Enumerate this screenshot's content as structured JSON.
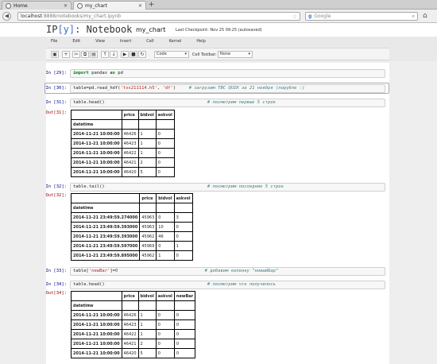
{
  "browser": {
    "tabs": [
      {
        "label": "Home",
        "active": false
      },
      {
        "label": "my_chart",
        "active": true
      }
    ],
    "url_host": "localhost",
    "url_path": ":8888/notebooks/my_chart.ipynb",
    "search_engine": "Google",
    "search_placeholder": "Google"
  },
  "header": {
    "logo_ip": "IP",
    "logo_y": "[y]",
    "logo_text": ": Notebook",
    "notebook_name": "my_chart",
    "checkpoint": "Last Checkpoint: Nov 25 09:25 (autosaved)"
  },
  "menu": [
    "File",
    "Edit",
    "View",
    "Insert",
    "Cell",
    "Kernel",
    "Help"
  ],
  "toolbar": {
    "cell_type": "Code",
    "cell_toolbar_label": "Cell Toolbar:",
    "cell_toolbar_value": "None"
  },
  "cells": [
    {
      "in": "In [29]:",
      "code_kw": "import",
      "code_mid": " pandas ",
      "code_kw2": "as",
      "code_end": " pd"
    },
    {
      "in": "In [30]:",
      "code_pre": "table=pd.read_hdf(",
      "str1": "'tvs211114.h5'",
      "sep": ", ",
      "str2": "'df'",
      "close": ")",
      "comment": "# загрузим TBC QUIK за 21 ноября (порубле :)"
    },
    {
      "in": "In [31]:",
      "code": "table.head()",
      "comment": "# посмотрим первые 5 строк",
      "out": "Out[31]:"
    },
    {
      "in": "In [32]:",
      "code": "table.tail()",
      "comment": "# посмотрим последние 5 строк",
      "out": "Out[32]:"
    },
    {
      "in": "In [33]:",
      "code_pre": "table[",
      "str1": "'newBar'",
      "code_post": "]=",
      "num": "0",
      "comment": "# добавим колонку \"новыйБар\""
    },
    {
      "in": "In [34]:",
      "code": "table.head()",
      "comment": "# посмотрим что получилось",
      "out": "Out[34]:"
    }
  ],
  "tables": {
    "head1": {
      "columns": [
        "price",
        "bidvol",
        "askvol"
      ],
      "index_name": "datetime",
      "rows": [
        [
          "2014-11-21 10:00:00",
          "46426",
          "1",
          "0"
        ],
        [
          "2014-11-21 10:00:00",
          "46423",
          "1",
          "0"
        ],
        [
          "2014-11-21 10:00:00",
          "46422",
          "1",
          "0"
        ],
        [
          "2014-11-21 10:00:00",
          "46421",
          "2",
          "0"
        ],
        [
          "2014-11-21 10:00:00",
          "46420",
          "5",
          "0"
        ]
      ]
    },
    "tail": {
      "columns": [
        "price",
        "bidvol",
        "askvol"
      ],
      "index_name": "datetime",
      "rows": [
        [
          "2014-11-21 23:49:59.274000",
          "45963",
          "0",
          "3"
        ],
        [
          "2014-11-21 23:49:59.393000",
          "45963",
          "10",
          "0"
        ],
        [
          "2014-11-21 23:49:59.393000",
          "45962",
          "46",
          "0"
        ],
        [
          "2014-11-21 23:49:59.597000",
          "45969",
          "0",
          "1"
        ],
        [
          "2014-11-21 23:49:59.895000",
          "45962",
          "1",
          "0"
        ]
      ]
    },
    "head2": {
      "columns": [
        "price",
        "bidvol",
        "askvol",
        "newBar"
      ],
      "index_name": "datetime",
      "rows": [
        [
          "2014-11-21 10:00:00",
          "46426",
          "1",
          "0",
          "0"
        ],
        [
          "2014-11-21 10:00:00",
          "46423",
          "1",
          "0",
          "0"
        ],
        [
          "2014-11-21 10:00:00",
          "46422",
          "1",
          "0",
          "0"
        ],
        [
          "2014-11-21 10:00:00",
          "46421",
          "2",
          "0",
          "0"
        ],
        [
          "2014-11-21 10:00:00",
          "46420",
          "5",
          "0",
          "0"
        ]
      ]
    }
  }
}
